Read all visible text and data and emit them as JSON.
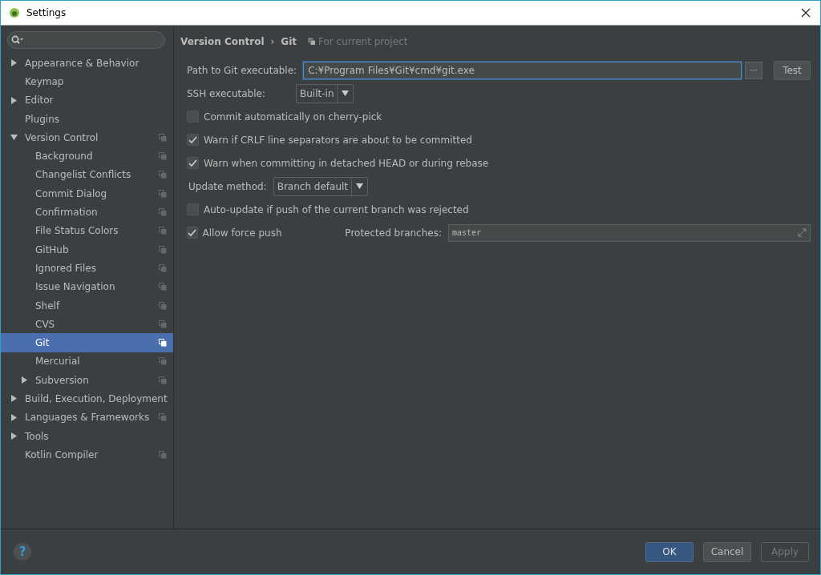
{
  "window": {
    "title": "Settings"
  },
  "sidebar": {
    "items": [
      {
        "label": "Appearance & Behavior",
        "kind": "group",
        "expanded": false,
        "project": false,
        "selected": false
      },
      {
        "label": "Keymap",
        "kind": "leaf",
        "project": false,
        "selected": false
      },
      {
        "label": "Editor",
        "kind": "group",
        "expanded": false,
        "project": false,
        "selected": false
      },
      {
        "label": "Plugins",
        "kind": "leaf",
        "project": false,
        "selected": false
      },
      {
        "label": "Version Control",
        "kind": "group",
        "expanded": true,
        "project": true,
        "selected": false,
        "children": [
          {
            "label": "Background",
            "kind": "leaf",
            "project": true,
            "selected": false
          },
          {
            "label": "Changelist Conflicts",
            "kind": "leaf",
            "project": true,
            "selected": false
          },
          {
            "label": "Commit Dialog",
            "kind": "leaf",
            "project": true,
            "selected": false
          },
          {
            "label": "Confirmation",
            "kind": "leaf",
            "project": true,
            "selected": false
          },
          {
            "label": "File Status Colors",
            "kind": "leaf",
            "project": true,
            "selected": false
          },
          {
            "label": "GitHub",
            "kind": "leaf",
            "project": true,
            "selected": false
          },
          {
            "label": "Ignored Files",
            "kind": "leaf",
            "project": true,
            "selected": false
          },
          {
            "label": "Issue Navigation",
            "kind": "leaf",
            "project": true,
            "selected": false
          },
          {
            "label": "Shelf",
            "kind": "leaf",
            "project": true,
            "selected": false
          },
          {
            "label": "CVS",
            "kind": "leaf",
            "project": true,
            "selected": false
          },
          {
            "label": "Git",
            "kind": "leaf",
            "project": true,
            "selected": true
          },
          {
            "label": "Mercurial",
            "kind": "leaf",
            "project": true,
            "selected": false
          },
          {
            "label": "Subversion",
            "kind": "group",
            "expanded": false,
            "project": true,
            "selected": false
          }
        ]
      },
      {
        "label": "Build, Execution, Deployment",
        "kind": "group",
        "expanded": false,
        "project": false,
        "selected": false
      },
      {
        "label": "Languages & Frameworks",
        "kind": "group",
        "expanded": false,
        "project": true,
        "selected": false
      },
      {
        "label": "Tools",
        "kind": "group",
        "expanded": false,
        "project": false,
        "selected": false
      },
      {
        "label": "Kotlin Compiler",
        "kind": "leaf",
        "project": true,
        "selected": false
      }
    ]
  },
  "breadcrumb": {
    "parent": "Version Control",
    "separator": "›",
    "current": "Git",
    "scope": "For current project"
  },
  "form": [
    {
      "kind": "path",
      "label": "Path to Git executable:",
      "value": "C:¥Program Files¥Git¥cmd¥git.exe",
      "browse": "···",
      "button": "Test"
    },
    {
      "kind": "select",
      "label": "SSH executable:",
      "value": "Built-in"
    },
    {
      "kind": "checkbox",
      "label": "Commit automatically on cherry-pick",
      "checked": false
    },
    {
      "kind": "checkbox",
      "label": "Warn if CRLF line separators are about to be committed",
      "checked": true
    },
    {
      "kind": "checkbox",
      "label": "Warn when committing in detached HEAD or during rebase",
      "checked": true
    },
    {
      "kind": "select",
      "label": "Update method:",
      "value": "Branch default"
    },
    {
      "kind": "checkbox",
      "label": "Auto-update if push of the current branch was rejected",
      "checked": false
    },
    {
      "kind": "checkbox-field",
      "label": "Allow force push",
      "checked": true,
      "field_label": "Protected branches:",
      "value": "master"
    }
  ],
  "footer": {
    "help": "?",
    "buttons": [
      {
        "label": "OK",
        "kind": "default",
        "disabled": false
      },
      {
        "label": "Cancel",
        "kind": "normal",
        "disabled": false
      },
      {
        "label": "Apply",
        "kind": "normal",
        "disabled": true
      }
    ]
  }
}
